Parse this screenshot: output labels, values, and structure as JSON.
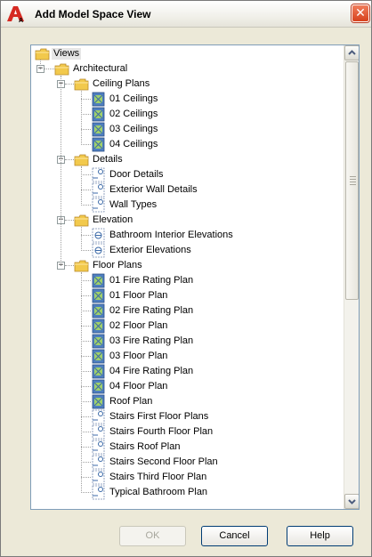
{
  "window": {
    "title": "Add Model Space View",
    "close_symbol": "✕",
    "logo_icon": "autocad-app-icon",
    "logo_sub": "A"
  },
  "tree": {
    "root": "Views",
    "architectural": "Architectural",
    "ceiling_plans": {
      "label": "Ceiling Plans",
      "items": [
        "01 Ceilings",
        "02 Ceilings",
        "03 Ceilings",
        "04 Ceilings"
      ]
    },
    "details": {
      "label": "Details",
      "items": [
        "Door Details",
        "Exterior Wall Details",
        "Wall Types"
      ]
    },
    "elevation": {
      "label": "Elevation",
      "items": [
        "Bathroom Interior Elevations",
        "Exterior Elevations"
      ]
    },
    "floor_plans": {
      "label": "Floor Plans",
      "items": [
        "01 Fire Rating Plan",
        "01 Floor Plan",
        "02 Fire Rating Plan",
        "02 Floor Plan",
        "03 Fire Rating Plan",
        "03 Floor Plan",
        "04 Fire Rating Plan",
        "04 Floor Plan",
        "Roof Plan",
        "Stairs First Floor Plans",
        "Stairs Fourth Floor Plan",
        "Stairs Roof Plan",
        "Stairs Second Floor Plan",
        "Stairs Third Floor Plan",
        "Typical Bathroom Plan"
      ],
      "item_icons": [
        "plan",
        "plan",
        "plan",
        "plan",
        "plan",
        "plan",
        "plan",
        "plan",
        "plan",
        "detail",
        "detail",
        "detail",
        "detail",
        "detail",
        "detail"
      ]
    }
  },
  "buttons": {
    "ok": "OK",
    "cancel": "Cancel",
    "help": "Help"
  },
  "colors": {
    "dialog_bg": "#ece9d8",
    "close_red": "#d7411d",
    "folder_yellow": "#f2c94c",
    "plan_icon_blue": "#4f7fc0"
  }
}
